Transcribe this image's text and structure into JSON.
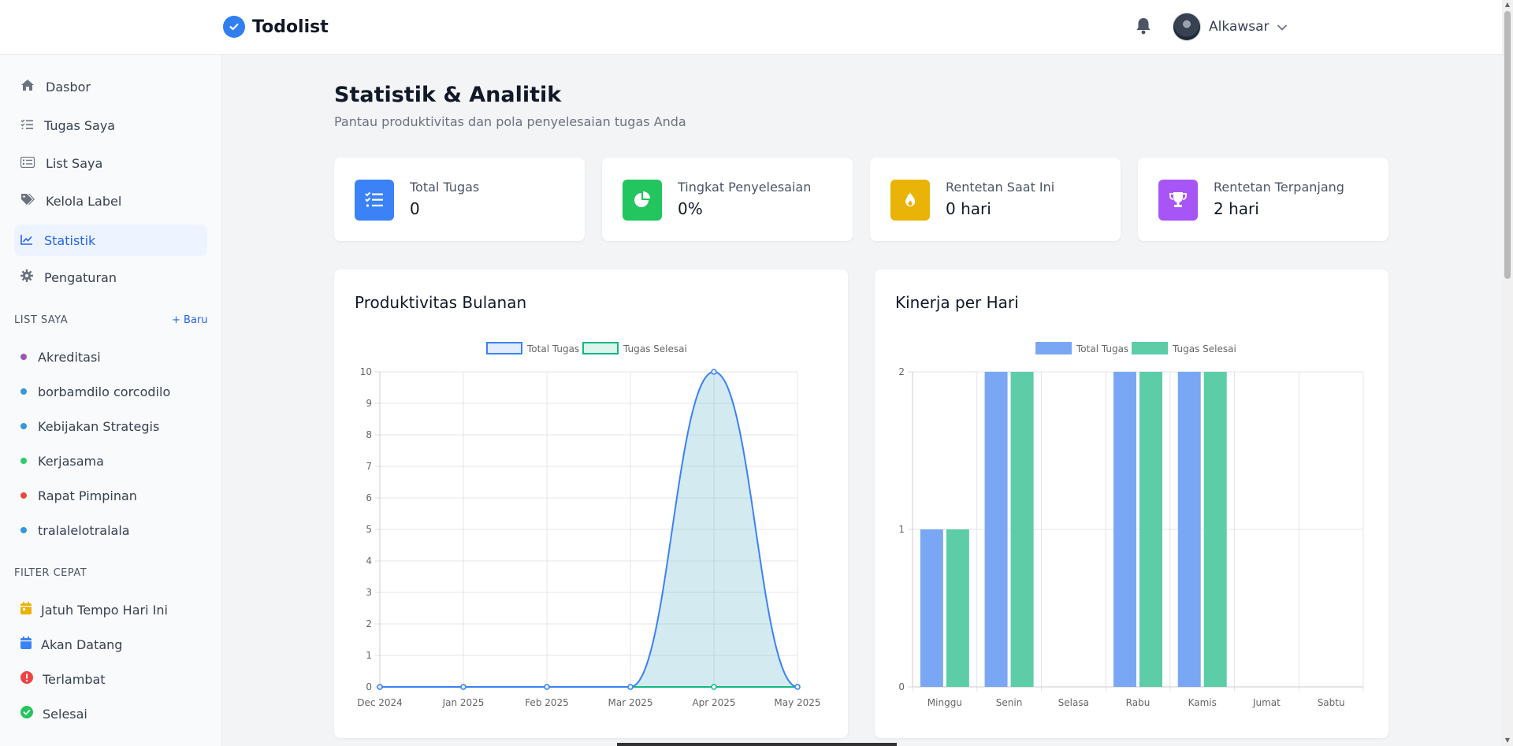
{
  "app": {
    "name": "Todolist"
  },
  "header": {
    "user_name": "Alkawsar"
  },
  "sidebar": {
    "nav": [
      {
        "label": "Dasbor",
        "icon": "home-icon"
      },
      {
        "label": "Tugas Saya",
        "icon": "tasks-icon"
      },
      {
        "label": "List Saya",
        "icon": "list-icon"
      },
      {
        "label": "Kelola Label",
        "icon": "tags-icon"
      },
      {
        "label": "Statistik",
        "icon": "chart-line-icon",
        "active": true
      },
      {
        "label": "Pengaturan",
        "icon": "gear-icon"
      }
    ],
    "lists_title": "LIST SAYA",
    "new_label": "Baru",
    "lists": [
      {
        "label": "Akreditasi",
        "color": "#9b59b6"
      },
      {
        "label": "borbamdilo corcodilo",
        "color": "#3498db"
      },
      {
        "label": "Kebijakan Strategis",
        "color": "#3498db"
      },
      {
        "label": "Kerjasama",
        "color": "#2ecc71"
      },
      {
        "label": "Rapat Pimpinan",
        "color": "#e74c3c"
      },
      {
        "label": "tralalelotralala",
        "color": "#3498db"
      }
    ],
    "filters_title": "FILTER CEPAT",
    "filters": [
      {
        "label": "Jatuh Tempo Hari Ini",
        "icon": "calendar-day-icon",
        "color": "#eab308"
      },
      {
        "label": "Akan Datang",
        "icon": "calendar-icon",
        "color": "#3b82f6"
      },
      {
        "label": "Terlambat",
        "icon": "exclamation-icon",
        "color": "#ef4444"
      },
      {
        "label": "Selesai",
        "icon": "check-circle-icon",
        "color": "#22c55e"
      }
    ]
  },
  "main": {
    "title": "Statistik & Analitik",
    "subtitle": "Pantau produktivitas dan pola penyelesaian tugas Anda",
    "stats": [
      {
        "label": "Total Tugas",
        "value": "0",
        "icon": "tasks-icon",
        "color": "#3b82f6"
      },
      {
        "label": "Tingkat Penyelesaian",
        "value": "0%",
        "icon": "chart-pie-icon",
        "color": "#22c55e"
      },
      {
        "label": "Rentetan Saat Ini",
        "value": "0 hari",
        "icon": "fire-icon",
        "color": "#eab308"
      },
      {
        "label": "Rentetan Terpanjang",
        "value": "2 hari",
        "icon": "trophy-icon",
        "color": "#a855f7"
      }
    ],
    "monthly_title": "Produktivitas Bulanan",
    "daily_title": "Kinerja per Hari"
  },
  "chart_data": [
    {
      "type": "line",
      "title": "Produktivitas Bulanan",
      "x": [
        "Dec 2024",
        "Jan 2025",
        "Feb 2025",
        "Mar 2025",
        "Apr 2025",
        "May 2025"
      ],
      "series": [
        {
          "name": "Total Tugas",
          "values": [
            0,
            0,
            0,
            0,
            10,
            0
          ],
          "color": "#3b82f6"
        },
        {
          "name": "Tugas Selesai",
          "values": [
            0,
            0,
            0,
            0,
            0,
            0
          ],
          "color": "#10b981"
        }
      ],
      "ylim": [
        0,
        10
      ],
      "yticks": [
        0,
        1,
        2,
        3,
        4,
        5,
        6,
        7,
        8,
        9,
        10
      ],
      "legend": "top",
      "grid": true
    },
    {
      "type": "bar",
      "title": "Kinerja per Hari",
      "categories": [
        "Minggu",
        "Senin",
        "Selasa",
        "Rabu",
        "Kamis",
        "Jumat",
        "Sabtu"
      ],
      "series": [
        {
          "name": "Total Tugas",
          "values": [
            1,
            2,
            0,
            2,
            2,
            0,
            0
          ],
          "color": "#7aa7f4"
        },
        {
          "name": "Tugas Selesai",
          "values": [
            1,
            2,
            0,
            2,
            2,
            0,
            0
          ],
          "color": "#5ccda6"
        }
      ],
      "ylim": [
        0,
        2
      ],
      "yticks": [
        0,
        1,
        2
      ],
      "legend": "top",
      "grid": true
    }
  ]
}
